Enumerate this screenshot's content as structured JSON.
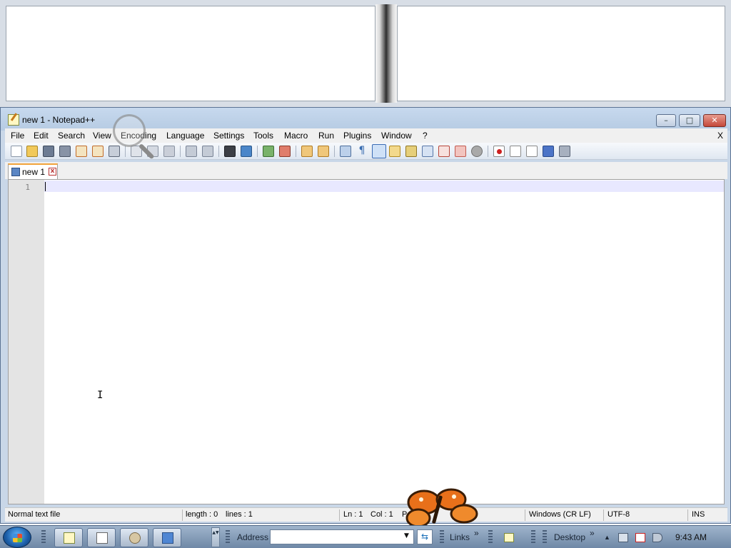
{
  "window": {
    "title": "new 1 - Notepad++",
    "minimize": "–",
    "maximize": "□",
    "close": "✕"
  },
  "menu": {
    "items": [
      "File",
      "Edit",
      "Search",
      "View",
      "Encoding",
      "Language",
      "Settings",
      "Tools",
      "Macro",
      "Run",
      "Plugins",
      "Window",
      "?"
    ],
    "close_doc": "X"
  },
  "toolbar": {
    "icons": [
      "new-file-icon",
      "open-file-icon",
      "save-icon",
      "save-all-icon",
      "close-icon",
      "close-all-icon",
      "print-icon",
      "cut-icon",
      "copy-icon",
      "paste-icon",
      "undo-icon",
      "redo-icon",
      "find-icon",
      "replace-icon",
      "zoom-in-icon",
      "zoom-out-icon",
      "sync-vertical-icon",
      "sync-horizontal-icon",
      "word-wrap-icon",
      "show-all-chars-icon",
      "indent-guide-icon",
      "user-defined-lang-icon",
      "doc-map-icon",
      "function-list-icon",
      "folder-workspace-icon",
      "monitoring-icon",
      "record-macro-icon",
      "stop-macro-icon",
      "play-macro-icon",
      "run-macro-multiple-icon",
      "save-macro-icon"
    ]
  },
  "tabs": [
    {
      "label": "new 1",
      "close": "x"
    }
  ],
  "editor": {
    "line_numbers": [
      "1"
    ],
    "content": "",
    "mouse_cursor": "I"
  },
  "statusbar": {
    "file_type": "Normal text file",
    "length": "length : 0",
    "lines": "lines : 1",
    "ln": "Ln : 1",
    "col": "Col : 1",
    "pos": "P",
    "eol": "Windows (CR LF)",
    "encoding": "UTF-8",
    "mode": "INS"
  },
  "taskbar": {
    "address_label": "Address",
    "address_value": "",
    "address_dropdown": "▼",
    "go": "⇆",
    "links_label": "Links",
    "links_chevron": "»",
    "desktop_label": "Desktop",
    "desktop_chevron": "»",
    "tray_arrow": "▲",
    "clock": "9:43 AM",
    "scroll": "▲▼"
  },
  "colors": {
    "accent_tab": "#f2a33a",
    "current_line": "#e8e8ff",
    "gutter": "#e4e4e4",
    "title_bar": "#b6cbe3",
    "close_button": "#c4483a"
  }
}
